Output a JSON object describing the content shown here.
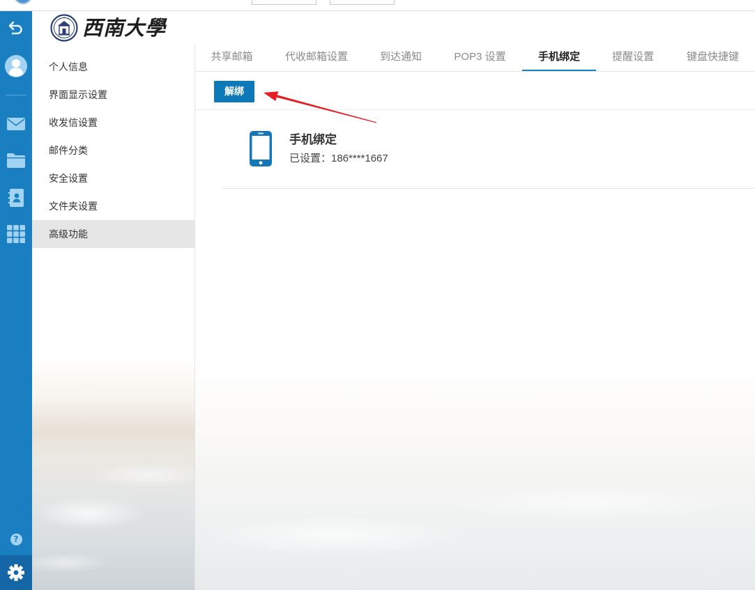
{
  "colors": {
    "rail": "#1a7fc1",
    "rail_settings_active": "#1466a6",
    "accent": "#1a7fc1",
    "button": "#0e79b8",
    "phone_icon": "#1677b7",
    "annotation_arrow": "#e31e24"
  },
  "rail": {
    "items": [
      {
        "icon": "back-arrow-icon"
      },
      {
        "icon": "avatar-icon"
      },
      {
        "icon": "mail-icon"
      },
      {
        "icon": "folder-icon"
      },
      {
        "icon": "contacts-icon"
      },
      {
        "icon": "apps-grid-icon"
      },
      {
        "icon": "help-icon"
      },
      {
        "icon": "gear-icon",
        "active": true
      }
    ],
    "help_glyph": "?"
  },
  "header": {
    "logo_icon": "university-seal-icon",
    "logo_text": "西南大學"
  },
  "sidebar": {
    "items": [
      {
        "label": "个人信息",
        "selected": false
      },
      {
        "label": "界面显示设置",
        "selected": false
      },
      {
        "label": "收发信设置",
        "selected": false
      },
      {
        "label": "邮件分类",
        "selected": false
      },
      {
        "label": "安全设置",
        "selected": false
      },
      {
        "label": "文件夹设置",
        "selected": false
      },
      {
        "label": "高级功能",
        "selected": true
      }
    ]
  },
  "tabs": [
    {
      "label": "共享邮箱",
      "active": false
    },
    {
      "label": "代收邮箱设置",
      "active": false
    },
    {
      "label": "到达通知",
      "active": false
    },
    {
      "label": "POP3 设置",
      "active": false
    },
    {
      "label": "手机绑定",
      "active": true
    },
    {
      "label": "提醒设置",
      "active": false
    },
    {
      "label": "键盘快捷键",
      "active": false
    }
  ],
  "toolbar": {
    "unbind_label": "解绑"
  },
  "binding": {
    "icon": "mobile-phone-icon",
    "title": "手机绑定",
    "status": "已设置：186****1667"
  }
}
